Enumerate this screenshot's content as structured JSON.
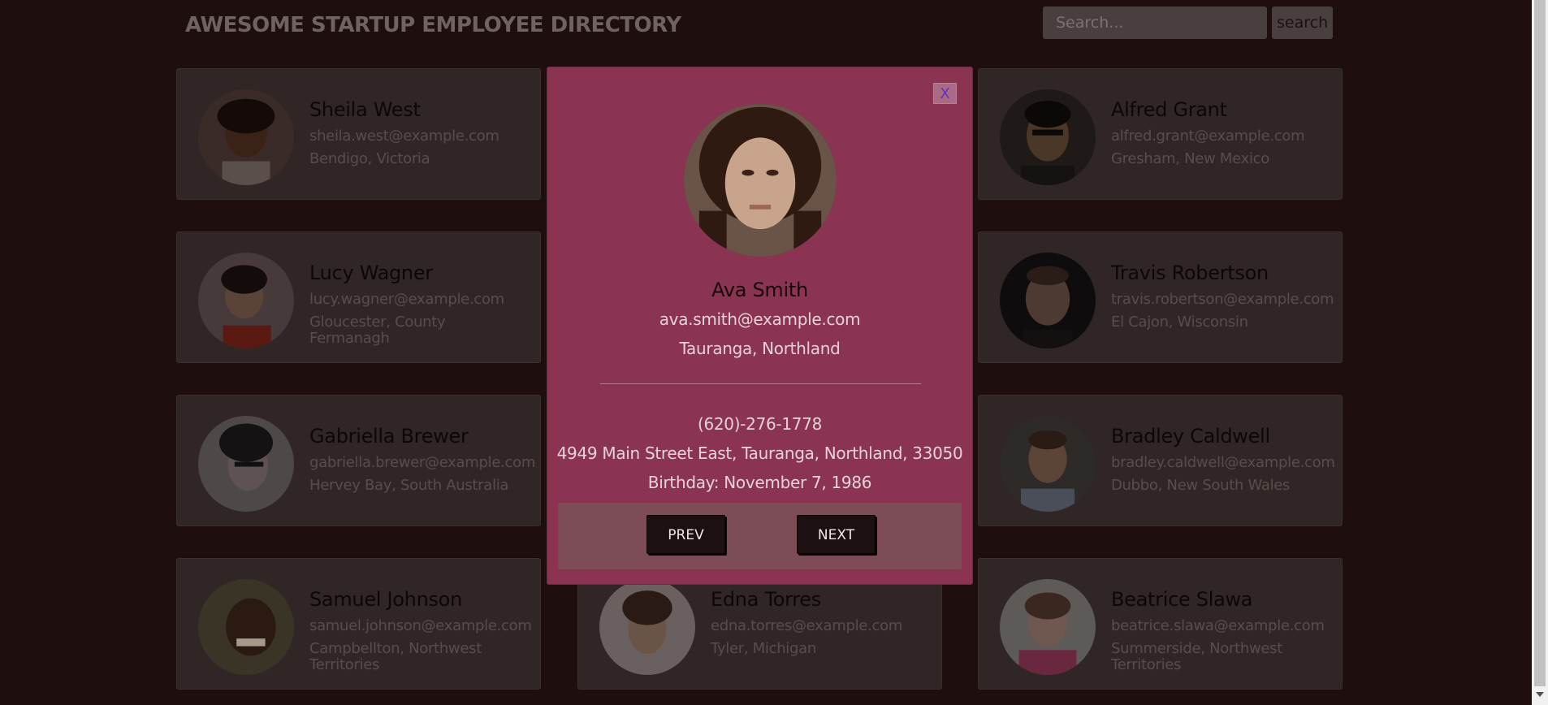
{
  "header": {
    "title": "AWESOME STARTUP EMPLOYEE DIRECTORY",
    "search_placeholder": "Search...",
    "search_button": "search"
  },
  "employees": [
    {
      "name": "Sheila West",
      "email": "sheila.west@example.com",
      "location": "Bendigo, Victoria"
    },
    {
      "name": "Alfred Grant",
      "email": "alfred.grant@example.com",
      "location": "Gresham, New Mexico"
    },
    {
      "name": "Lucy Wagner",
      "email": "lucy.wagner@example.com",
      "location": "Gloucester, County Fermanagh"
    },
    {
      "name": "Travis Robertson",
      "email": "travis.robertson@example.com",
      "location": "El Cajon, Wisconsin"
    },
    {
      "name": "Gabriella Brewer",
      "email": "gabriella.brewer@example.com",
      "location": "Hervey Bay, South Australia"
    },
    {
      "name": "Bradley Caldwell",
      "email": "bradley.caldwell@example.com",
      "location": "Dubbo, New South Wales"
    },
    {
      "name": "Samuel Johnson",
      "email": "samuel.johnson@example.com",
      "location": "Campbellton, Northwest Territories"
    },
    {
      "name": "Edna Torres",
      "email": "edna.torres@example.com",
      "location": "Tyler, Michigan"
    },
    {
      "name": "Beatrice Slawa",
      "email": "beatrice.slawa@example.com",
      "location": "Summerside, Northwest Territories"
    }
  ],
  "modal": {
    "close_label": "X",
    "name": "Ava Smith",
    "email": "ava.smith@example.com",
    "location": "Tauranga, Northland",
    "phone": "(620)-276-1778",
    "address": "4949 Main Street East, Tauranga, Northland, 33050",
    "birthday": "Birthday: November 7, 1986",
    "prev_label": "PREV",
    "next_label": "NEXT"
  },
  "colors": {
    "page_background": "#1e0e0d",
    "modal_background": "#8b3353",
    "card_background": "#312626"
  }
}
